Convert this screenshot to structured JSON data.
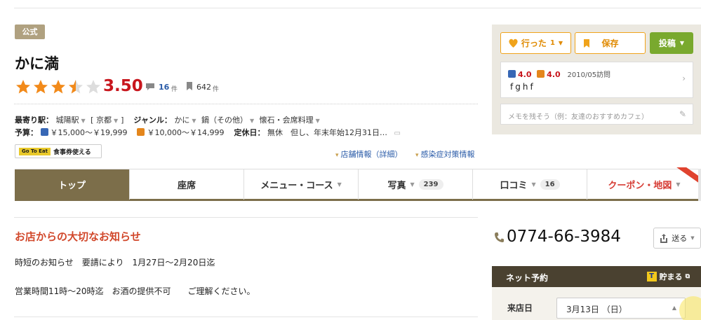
{
  "header": {
    "official_badge": "公式",
    "shop_name": "かに満",
    "rating": "3.50",
    "rating_stars": 3.5,
    "review_count": "16",
    "review_unit": "件",
    "bookmark_count": "642",
    "bookmark_unit": "件"
  },
  "info": {
    "station_label": "最寄り駅：",
    "station": "城陽駅",
    "area_open": "[",
    "area": "京都",
    "area_close": "]",
    "genre_label": "ジャンル：",
    "genre1": "かに",
    "genre2": "鍋（その他）",
    "genre3": "懐石・会席料理",
    "budget_label": "予算：",
    "budget_dinner": "￥15,000～￥19,999",
    "budget_lunch": "￥10,000～￥14,999",
    "holiday_label": "定休日：",
    "holiday": "無休　但し、年末年始12月31日…"
  },
  "gotoeat": {
    "logo": "Go To Eat",
    "text": "食事券使える"
  },
  "links": {
    "shop_info": "店舗情報（詳細）",
    "covid": "感染症対策情報"
  },
  "tabs": [
    {
      "label": "トップ"
    },
    {
      "label": "座席"
    },
    {
      "label": "メニュー・コース"
    },
    {
      "label": "写真",
      "count": "239"
    },
    {
      "label": "口コミ",
      "count": "16"
    },
    {
      "label": "クーポン・地図"
    }
  ],
  "notice": {
    "title": "お店からの大切なお知らせ",
    "line1": "時短のお知らせ　要請により　1月27日～2月20日迄",
    "line2": "営業時間11時～20時迄　お酒の提供不可　　ご理解ください。"
  },
  "actions": {
    "went_label": "行った",
    "went_count": "1",
    "save_label": "保存",
    "post_label": "投稿"
  },
  "visit": {
    "dinner_score": "4.0",
    "lunch_score": "4.0",
    "date": "2010/05訪問",
    "note": "fghf"
  },
  "memo": {
    "placeholder": "メモを残そう（例：友達のおすすめカフェ）"
  },
  "contact": {
    "phone": "0774-66-3984",
    "send_label": "送る"
  },
  "reservation": {
    "title": "ネット予約",
    "tpoint_label": "貯まる",
    "date_label": "来店日",
    "date_value": "3月13日 （日）"
  },
  "colors": {
    "accent": "#7c6e4a",
    "rating_red": "#c8161d",
    "star_orange": "#f28a1a",
    "post_green": "#79a92e"
  }
}
